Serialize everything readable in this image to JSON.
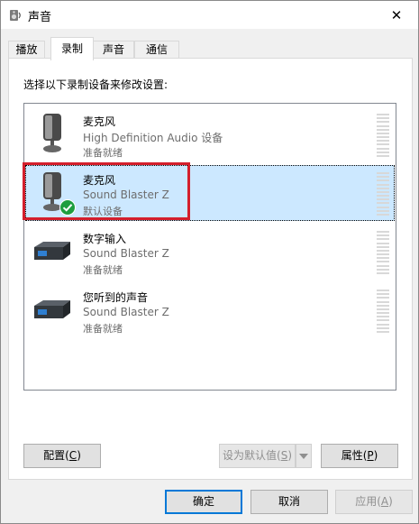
{
  "window": {
    "title": "声音",
    "close_glyph": "✕"
  },
  "tabs": [
    {
      "label": "播放",
      "active": false
    },
    {
      "label": "录制",
      "active": true
    },
    {
      "label": "声音",
      "active": false
    },
    {
      "label": "通信",
      "active": false
    }
  ],
  "instruction": "选择以下录制设备来修改设置:",
  "devices": [
    {
      "name": "麦克风",
      "detail": "High Definition Audio 设备",
      "status": "准备就绪",
      "icon": "microphone-icon",
      "selected": false,
      "default": false
    },
    {
      "name": "麦克风",
      "detail": "Sound Blaster Z",
      "status": "默认设备",
      "icon": "microphone-icon",
      "selected": true,
      "default": true
    },
    {
      "name": "数字输入",
      "detail": "Sound Blaster Z",
      "status": "准备就绪",
      "icon": "digital-input-icon",
      "selected": false,
      "default": false
    },
    {
      "name": "您听到的声音",
      "detail": "Sound Blaster Z",
      "status": "准备就绪",
      "icon": "digital-input-icon",
      "selected": false,
      "default": false
    }
  ],
  "buttons": {
    "configure": {
      "label": "配置(",
      "key": "C",
      "suffix": ")"
    },
    "set_default": {
      "label": "设为默认值(",
      "key": "S",
      "suffix": ")",
      "enabled": false
    },
    "properties": {
      "label": "属性(",
      "key": "P",
      "suffix": ")"
    },
    "ok": {
      "label": "确定"
    },
    "cancel": {
      "label": "取消"
    },
    "apply": {
      "label": "应用(",
      "key": "A",
      "suffix": ")",
      "enabled": false
    }
  },
  "colors": {
    "selection": "#cce8ff",
    "highlight_box": "#d41f2c",
    "default_check": "#1e9e3e",
    "primary_border": "#0078d7"
  }
}
